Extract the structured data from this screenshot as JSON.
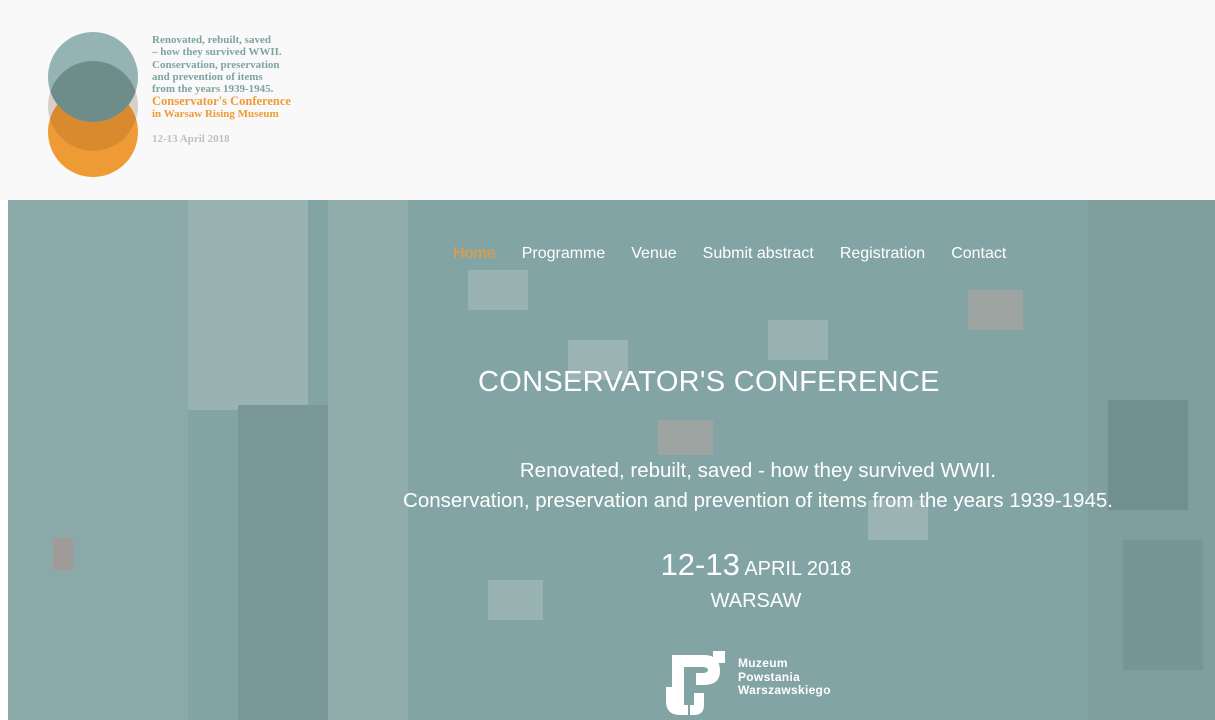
{
  "logo": {
    "lines": [
      "Renovated, rebuilt, saved",
      "– how they survived WWII.",
      "Conservation, preservation",
      "and prevention of items",
      "from the years 1939-1945."
    ],
    "conference_line": "Conservator's Conference",
    "museum_line": "in Warsaw Rising Museum",
    "date": "12-13 April 2018",
    "colors": {
      "teal": "#7ea3a3",
      "orange": "#ef9b35",
      "grey": "#bfb8b1"
    }
  },
  "nav": {
    "items": [
      "Home",
      "Programme",
      "Venue",
      "Submit abstract",
      "Registration",
      "Contact"
    ],
    "active_index": 0,
    "active_color": "#ef9b35"
  },
  "hero": {
    "title": "CONSERVATOR'S CONFERENCE",
    "subtitle_line1": "Renovated, rebuilt, saved - how they survived WWII.",
    "subtitle_line2": "Conservation, preservation and prevention of items from the years 1939-1945.",
    "date_days": "12-13",
    "date_month_year": "APRIL 2018",
    "city": "WARSAW"
  },
  "museum_logo": {
    "lines": [
      "Muzeum",
      "Powstania",
      "Warszawskiego"
    ],
    "icon": "anchor-symbol-icon"
  }
}
